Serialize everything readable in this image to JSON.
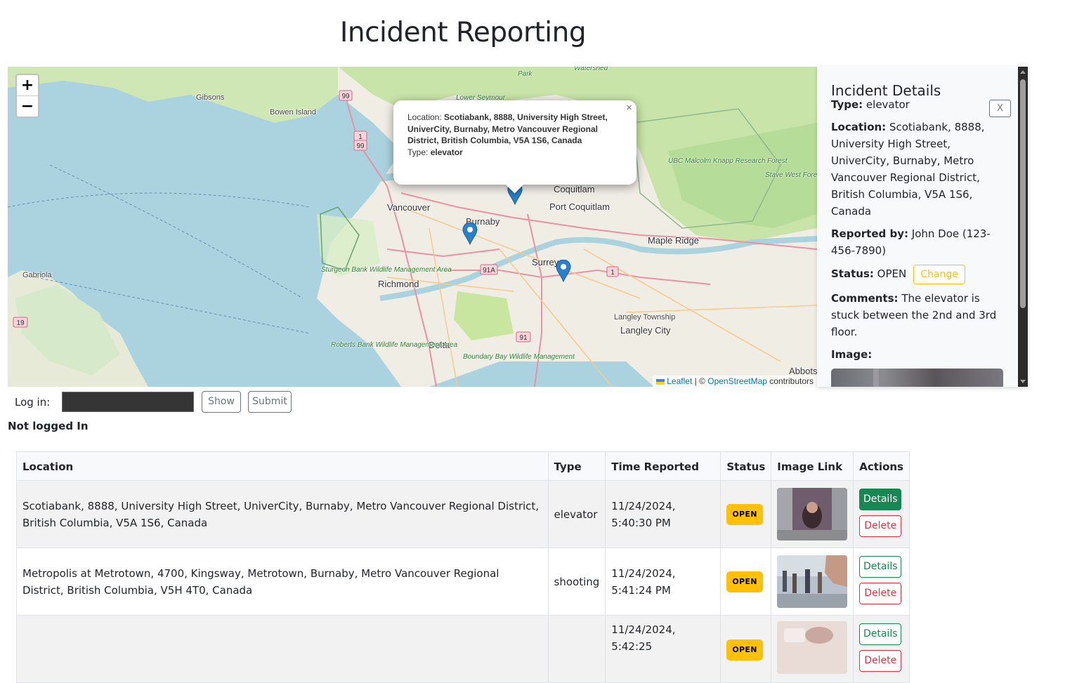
{
  "page": {
    "title": "Incident Reporting"
  },
  "map": {
    "zoom_in": "+",
    "zoom_out": "−",
    "labels": {
      "gibsons": "Gibsons",
      "bowen": "Bowen Island",
      "vancouver": "Vancouver",
      "burnaby": "Burnaby",
      "coquitlam": "Coquitlam",
      "port_coquitlam": "Port Coquitlam",
      "maple_ridge": "Maple Ridge",
      "richmond": "Richmond",
      "surrey": "Surrey",
      "delta": "Delta",
      "langley_township": "Langley Township",
      "langley_city": "Langley City",
      "gabriola": "Gabriola",
      "abbotsford": "Abbots",
      "lower_seymour": "Lower Seymour",
      "watershed": "Watershed",
      "park": "Park",
      "ubc_malcolm": "UBC Malcolm Knapp Research Forest",
      "stave_west": "Stave West Forest & Recreation Area",
      "sturgeon": "Sturgeon Bank Wildlife Management Area",
      "roberts": "Roberts Bank Wildlife Management Area",
      "boundary": "Boundary Bay Wildlife Management"
    },
    "route_shields": {
      "r99a": "99",
      "r1": "1",
      "r99b": "99",
      "r91a": "91A",
      "r1b": "1",
      "r91": "91",
      "r19": "19"
    },
    "popup": {
      "location_label": "Location:",
      "location_value": "Scotiabank, 8888, University High Street, UniverCity, Burnaby, Metro Vancouver Regional District, British Columbia, V5A 1S6, Canada",
      "type_label": "Type:",
      "type_value": "elevator",
      "close": "×"
    },
    "attribution": {
      "leaflet": "Leaflet",
      "sep": " | © ",
      "osm": "OpenStreetMap",
      "contributors": " contributors"
    }
  },
  "details": {
    "heading": "Incident Details",
    "close_label": "X",
    "type_label": "Type:",
    "type_value": "elevator",
    "location_label": "Location:",
    "location_value": "Scotiabank, 8888, University High Street, UniverCity, Burnaby, Metro Vancouver Regional District, British Columbia, V5A 1S6, Canada",
    "reported_label": "Reported by:",
    "reported_value": "John Doe (123-456-7890)",
    "status_label": "Status:",
    "status_value": "OPEN",
    "change_label": "Change",
    "comments_label": "Comments:",
    "comments_value": "The elevator is stuck between the 2nd and 3rd floor.",
    "image_label": "Image:"
  },
  "login": {
    "label": "Log in:",
    "show_label": "Show",
    "submit_label": "Submit",
    "status": "Not logged In"
  },
  "table": {
    "headers": [
      "Location",
      "Type",
      "Time Reported",
      "Status",
      "Image Link",
      "Actions"
    ],
    "rows": [
      {
        "location": "Scotiabank, 8888, University High Street, UniverCity, Burnaby, Metro Vancouver Regional District, British Columbia, V5A 1S6, Canada",
        "type": "elevator",
        "time": "11/24/2024, 5:40:30 PM",
        "status": "OPEN",
        "details": "Details",
        "delete": "Delete"
      },
      {
        "location": "Metropolis at Metrotown, 4700, Kingsway, Metrotown, Burnaby, Metro Vancouver Regional District, British Columbia, V5H 4T0, Canada",
        "type": "shooting",
        "time": "11/24/2024, 5:41:24 PM",
        "status": "OPEN",
        "details": "Details",
        "delete": "Delete"
      },
      {
        "location": "",
        "type": "",
        "time": "11/24/2024, 5:42:25",
        "status": "OPEN",
        "details": "Details",
        "delete": "Delete"
      }
    ]
  },
  "colors": {
    "open_badge": "#ffc107",
    "details_active": "#198754",
    "delete": "#dc3545",
    "marker": "#2a81cb"
  }
}
